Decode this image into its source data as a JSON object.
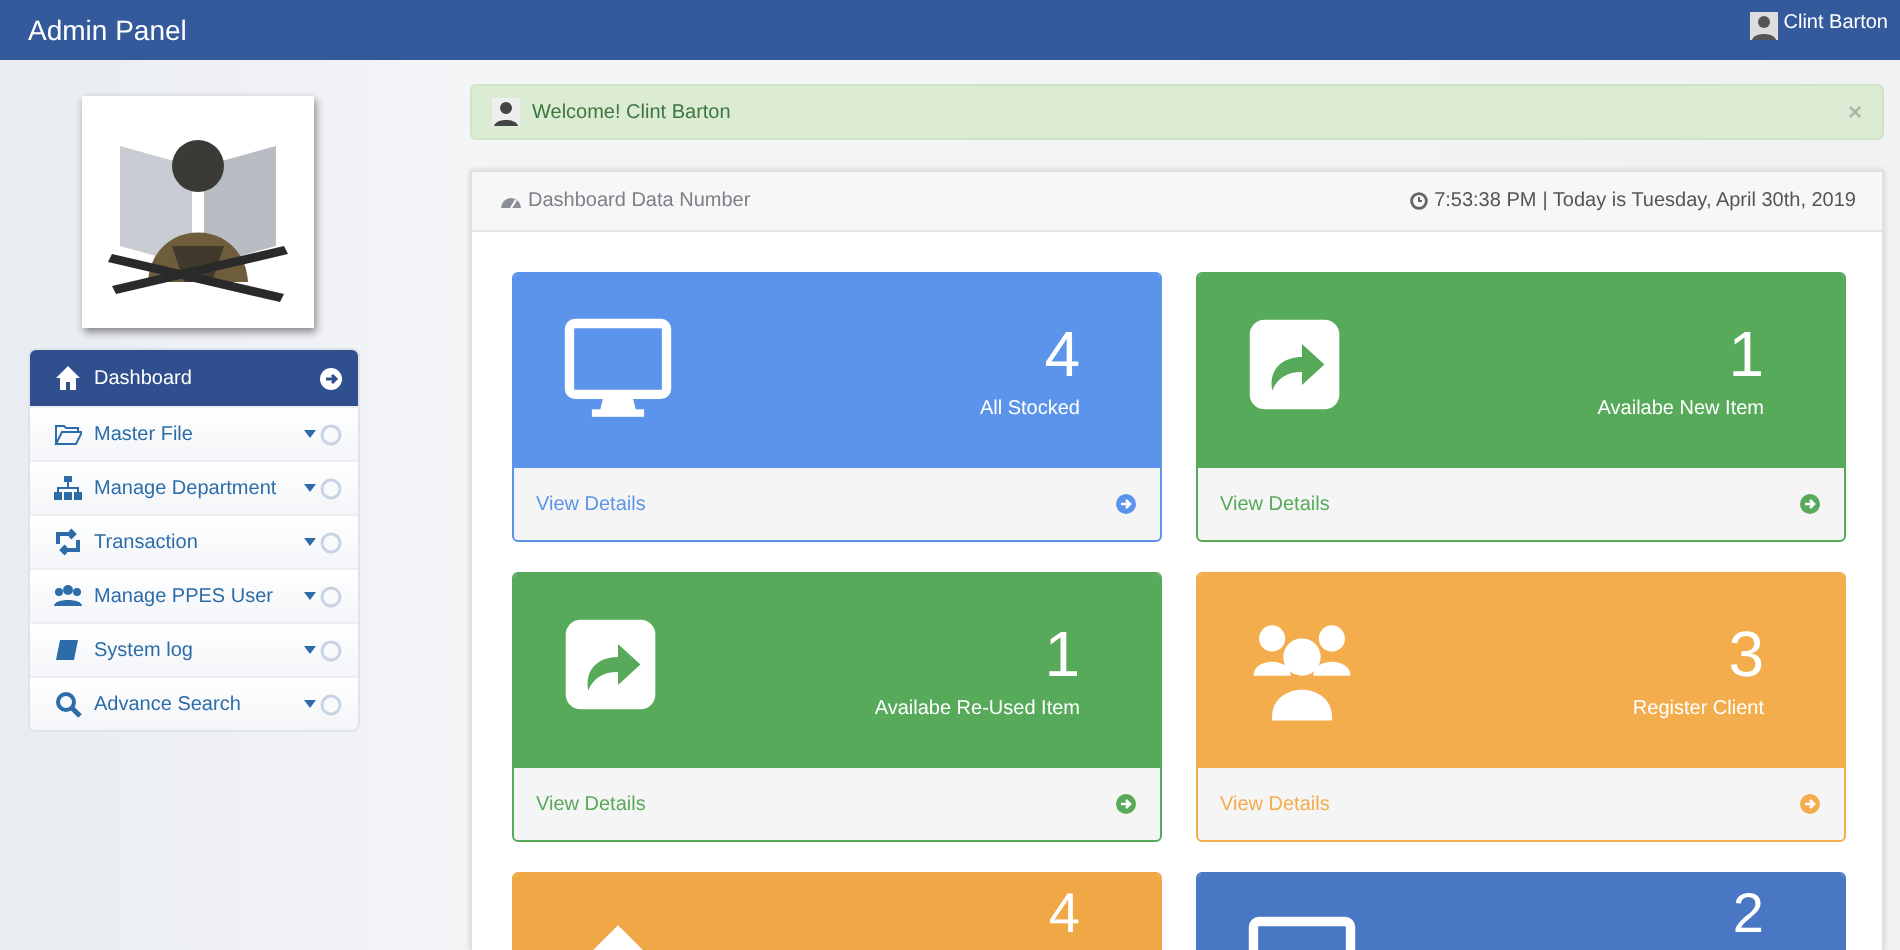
{
  "header": {
    "title": "Admin Panel",
    "user": "Clint Barton"
  },
  "sidebar": {
    "items": [
      {
        "label": "Dashboard",
        "selected": true
      },
      {
        "label": "Master File",
        "selected": false
      },
      {
        "label": "Manage Department",
        "selected": false
      },
      {
        "label": "Transaction",
        "selected": false
      },
      {
        "label": "Manage PPES User",
        "selected": false
      },
      {
        "label": "System log",
        "selected": false
      },
      {
        "label": "Advance Search",
        "selected": false
      }
    ]
  },
  "alert": {
    "text": "Welcome! Clint Barton",
    "close": "×"
  },
  "panel": {
    "title": "Dashboard Data Number",
    "time": "7:53:38 PM",
    "date": "| Today is Tuesday, April 30th, 2019",
    "cards": [
      {
        "kind": "monitor",
        "color": "#5b94ea",
        "value": "4",
        "label": "All Stocked",
        "link": "View Details"
      },
      {
        "kind": "share",
        "color": "#57aa5a",
        "value": "1",
        "label": "Availabe New Item",
        "link": "View Details"
      },
      {
        "kind": "share",
        "color": "#57aa5a",
        "value": "1",
        "label": "Availabe Re-Used Item",
        "link": "View Details"
      },
      {
        "kind": "users",
        "color": "#f3ad4c",
        "value": "3",
        "label": "Register Client",
        "link": "View Details"
      },
      {
        "kind": "home",
        "color": "#f0a846",
        "value": "4"
      },
      {
        "kind": "monitor",
        "color": "#4a77c4",
        "value": "2"
      }
    ]
  }
}
